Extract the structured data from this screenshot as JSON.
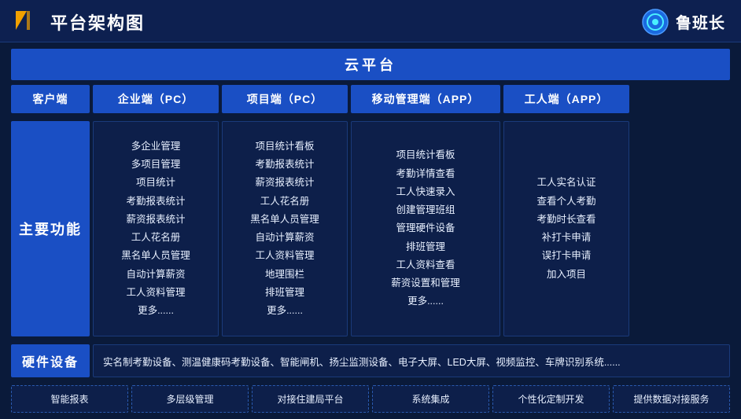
{
  "header": {
    "title": "平台架构图",
    "brand": "鲁班长"
  },
  "cloud": {
    "label": "云平台"
  },
  "columns": {
    "client": "客户端",
    "enterprise": "企业端（PC）",
    "project": "项目端（PC）",
    "mobile": "移动管理端（APP）",
    "worker": "工人端（APP）"
  },
  "rows": {
    "main_func_label": "主要功能",
    "enterprise_items": [
      "多企业管理",
      "多项目管理",
      "项目统计",
      "考勤报表统计",
      "薪资报表统计",
      "工人花名册",
      "黑名单人员管理",
      "自动计算薪资",
      "工人资料管理",
      "更多......"
    ],
    "project_items": [
      "项目统计看板",
      "考勤报表统计",
      "薪资报表统计",
      "工人花名册",
      "黑名单人员管理",
      "自动计算薪资",
      "工人资料管理",
      "地理围栏",
      "排班管理",
      "更多......"
    ],
    "mobile_items": [
      "项目统计看板",
      "考勤详情查看",
      "工人快速录入",
      "创建管理班组",
      "管理硬件设备",
      "排班管理",
      "工人资料查看",
      "薪资设置和管理",
      "更多......"
    ],
    "worker_items": [
      "工人实名认证",
      "查看个人考勤",
      "考勤时长查看",
      "补打卡申请",
      "误打卡申请",
      "加入项目"
    ]
  },
  "hardware": {
    "label": "硬件设备",
    "content": "实名制考勤设备、测温健康码考勤设备、智能闸机、扬尘监测设备、电子大屏、LED大屏、视频监控、车牌识别系统......"
  },
  "bottom_items": [
    "智能报表",
    "多层级管理",
    "对接住建局平台",
    "系统集成",
    "个性化定制开发",
    "提供数据对接服务"
  ]
}
